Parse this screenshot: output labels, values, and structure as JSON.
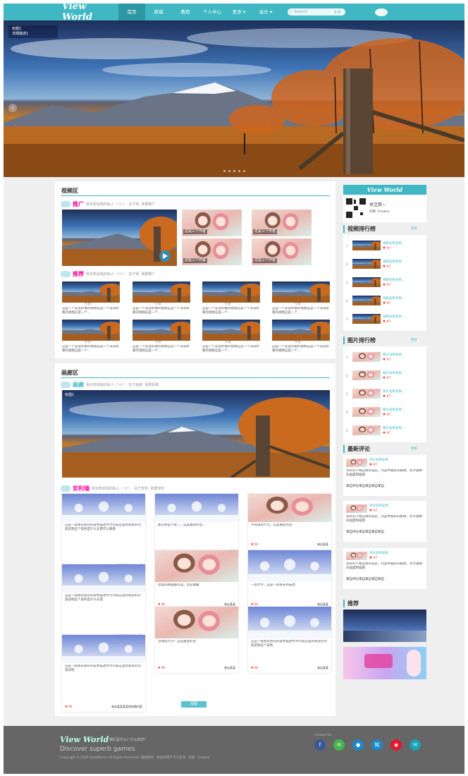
{
  "nav": {
    "logo": "View World",
    "items": [
      "首页",
      "商城",
      "教程",
      "个人中心",
      "更多",
      "音乐"
    ],
    "search_placeholder": "Search",
    "search_scope": "全部"
  },
  "hero": {
    "caption_title": "标题1",
    "caption_sub": "详细描述1"
  },
  "video": {
    "section_title": "视频区",
    "promo": {
      "name": "推广",
      "desc": "我也想说我的私人（'ㅂ'）",
      "link1": "关于我",
      "link2": "我要推广"
    },
    "tiles_caption": "这是三个作者",
    "recommend": {
      "name": "推荐",
      "desc": "我也想说我的私人（'ㅂ'）",
      "link1": "关于我",
      "link2": "我要推广"
    },
    "author": "作者",
    "item_text": "这是一个非常好看的视频这是一个非常好看的视频这是一个..."
  },
  "gallery": {
    "section_title": "画廊区",
    "banner_name": "画廊",
    "banner_desc": "我也想说我的私人（'ㅂ'）",
    "banner_link1": "关于画廊",
    "banner_link2": "我要投稿",
    "slide_caption": "标题1",
    "wall_name": "安利墙",
    "wall_desc": "我也想说我的私人（'ㅂ'）",
    "wall_link1": "关于安利",
    "wall_link2": "我要安利",
    "cards": [
      {
        "text": "这是一段很长很长的安利描述文字内容这里有很多的内容说明这个安利是什么东西可以看看",
        "likes": "98",
        "by": "来自某某某某的投稿内容"
      },
      {
        "text": "都已经是不会了，这是最后的话...",
        "likes": "98",
        "by": "来自某某"
      },
      {
        "text": "不知道说什么，这是最后的话",
        "likes": "98",
        "by": "来自某某"
      },
      {
        "text": "这是一段很长很长的安利描述文字内容这里有很多的内容说明这个安利是什么东西",
        "likes": "98",
        "by": "来自某某某某的投稿内容"
      },
      {
        "text": "动漫风格插画作品，欢迎收藏",
        "likes": "98",
        "by": "来自某某"
      },
      {
        "text": "一段文字，这是一段很长的描述",
        "likes": "98",
        "by": "来自某某"
      },
      {
        "text": "这是一段很长很长的安利描述文字内容这里有很多的内容说明",
        "likes": "98",
        "by": "来自某某某某的投稿内容"
      },
      {
        "text": "其他是什么？这是最后的话",
        "likes": "98",
        "by": "来自某某"
      },
      {
        "text": "这是一段很长很长的安利描述文字内容这里有很多的内容说明这个安利",
        "likes": "98",
        "by": "来自某某"
      }
    ],
    "more_label": "加载"
  },
  "sidebar": {
    "profile": {
      "logo": "View World",
      "follow": "关注我~",
      "author_label": "作者:",
      "author": "Eriakon"
    },
    "video_rank": {
      "title": "视频排行榜",
      "more": "更多",
      "items": [
        {
          "text": "视频名称名称...",
          "likes": "97"
        },
        {
          "text": "视频名称名称...",
          "likes": "97"
        },
        {
          "text": "视频名称名称...",
          "likes": "97"
        },
        {
          "text": "视频名称名称...",
          "likes": "97"
        },
        {
          "text": "视频名称名称...",
          "likes": "97"
        }
      ]
    },
    "pic_rank": {
      "title": "图片排行榜",
      "more": "更多",
      "items": [
        {
          "text": "图片名称名称...",
          "likes": "97"
        },
        {
          "text": "图片名称名称...",
          "likes": "97"
        },
        {
          "text": "图片名称名称...",
          "likes": "97"
        },
        {
          "text": "图片名称名称...",
          "likes": "97"
        },
        {
          "text": "图片名称名称...",
          "likes": "97"
        }
      ]
    },
    "comments": {
      "title": "最新评论",
      "more": "更多",
      "items": [
        {
          "name": "评论名称名称",
          "likes": "97",
          "text": "有好的人物这样的设定，作品中最好的剧情，有大量精彩画面和插图",
          "by": "来自评论来自来自来自来自"
        },
        {
          "name": "评论名称名称",
          "likes": "97",
          "text": "有好的人物这样的设定，作品中最好的剧情，有大量精彩画面和插图",
          "by": "来自评论来自来自来自来自"
        },
        {
          "name": "评论名称名称",
          "likes": "97",
          "text": "有好的人物这样的设定，作品中最好的剧情，有大量精彩画面和插图",
          "by": "来自评论来自来自来自来自"
        }
      ]
    },
    "recommend": {
      "title": "推荐"
    }
  },
  "footer": {
    "logo": "View World",
    "sub": "我们是什么? 什么样的?",
    "tagline": "Discover superb games.",
    "copy": "Copyright © 2016 ViewWorld. All Rights Reserved. 版权所有 · 本站仅用于学习交流 · 作者：Eriakon",
    "contact": "Contact Us",
    "social": [
      "f",
      "✉",
      "●",
      "知",
      "◉",
      "✉"
    ]
  },
  "colors": {
    "accent": "#3fb8c4",
    "pink": "#ff0099"
  }
}
